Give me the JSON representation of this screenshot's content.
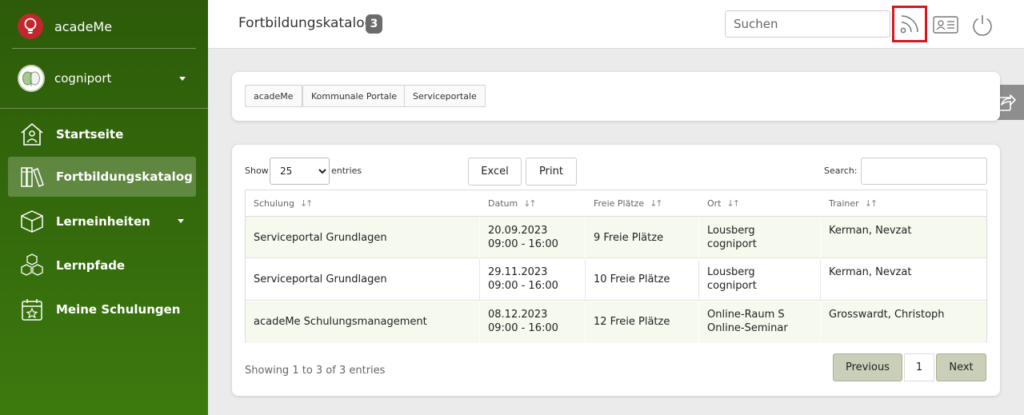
{
  "brand": {
    "name": "acadeMe"
  },
  "org": {
    "name": "cogniport"
  },
  "nav": [
    {
      "label": "Startseite",
      "icon": "home-icon"
    },
    {
      "label": "Fortbildungskatalog",
      "icon": "books-icon",
      "active": true
    },
    {
      "label": "Lerneinheiten",
      "icon": "cube-icon",
      "has_submenu": true
    },
    {
      "label": "Lernpfade",
      "icon": "cubes-icon"
    },
    {
      "label": "Meine Schulungen",
      "icon": "calendar-star-icon"
    }
  ],
  "header": {
    "title": "Fortbildungskatalog",
    "badge": "3",
    "search_placeholder": "Suchen",
    "icons": [
      "rss-icon",
      "id-card-icon",
      "power-icon"
    ]
  },
  "filters": [
    "acadeMe",
    "Kommunale Portale",
    "Serviceportale"
  ],
  "table_controls": {
    "show_label": "Show",
    "length_value": "25",
    "entries_label": "entries",
    "excel_label": "Excel",
    "print_label": "Print",
    "search_label": "Search:"
  },
  "table": {
    "columns": [
      "Schulung",
      "Datum",
      "Freie Plätze",
      "Ort",
      "Trainer"
    ],
    "rows": [
      {
        "schulung": "Serviceportal Grundlagen",
        "datum": "20.09.2023",
        "zeit": "09:00 - 16:00",
        "plaetze": "9 Freie Plätze",
        "ort1": "Lousberg",
        "ort2": "cogniport",
        "trainer": "Kerman, Nevzat"
      },
      {
        "schulung": "Serviceportal Grundlagen",
        "datum": "29.11.2023",
        "zeit": "09:00 - 16:00",
        "plaetze": "10 Freie Plätze",
        "ort1": "Lousberg",
        "ort2": "cogniport",
        "trainer": "Kerman, Nevzat"
      },
      {
        "schulung": "acadeMe Schulungsmanagement",
        "datum": "08.12.2023",
        "zeit": "09:00 - 16:00",
        "plaetze": "12 Freie Plätze",
        "ort1": "Online-Raum S",
        "ort2": "Online-Seminar",
        "trainer": "Grosswardt, Christoph"
      }
    ]
  },
  "footer": {
    "info": "Showing 1 to 3 of 3 entries",
    "previous": "Previous",
    "page": "1",
    "next": "Next"
  },
  "colors": {
    "sidebar": "#356a0c",
    "highlight": "#d7161e",
    "row_stripe": "#f5f9ee"
  }
}
